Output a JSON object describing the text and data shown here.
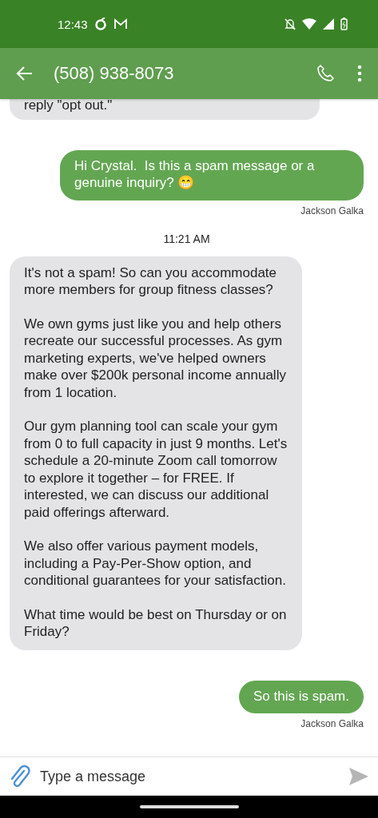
{
  "status_bar": {
    "time": "12:43"
  },
  "header": {
    "title": "(508) 938-8073"
  },
  "messages": [
    {
      "kind": "incoming",
      "text": "reply \"opt out.\""
    },
    {
      "kind": "outgoing",
      "text": "Hi Crystal.  Is this a spam message or a genuine inquiry? 😁",
      "sender": "Jackson Galka"
    },
    {
      "kind": "timestamp",
      "text": "11:21 AM"
    },
    {
      "kind": "incoming",
      "text": "It's not a spam! So can you accommodate more members for group fitness classes?\n\nWe own gyms just like you and help others recreate our successful processes. As gym marketing experts, we've helped owners make over $200k personal income annually from 1 location.\n\nOur gym planning tool can scale your gym from 0 to full capacity in just 9 months. Let's schedule a 20-minute Zoom call tomorrow to explore it together – for FREE. If interested, we can discuss our additional paid offerings afterward.\n\nWe also offer various payment models, including a Pay-Per-Show option, and conditional guarantees for your satisfaction.\n\nWhat time would be best on Thursday or on Friday?"
    },
    {
      "kind": "outgoing",
      "text": "So this is spam.",
      "sender": "Jackson Galka"
    }
  ],
  "composer": {
    "placeholder": "Type a message"
  }
}
